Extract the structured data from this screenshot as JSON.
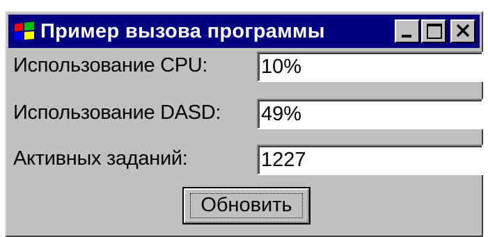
{
  "window": {
    "title": "Пример вызова программы",
    "icon": "windows-flag-icon",
    "controls": {
      "minimize": "minimize-icon",
      "maximize": "maximize-icon",
      "close": "close-icon"
    }
  },
  "form": {
    "fields": [
      {
        "label": "Использование CPU:",
        "value": "10%"
      },
      {
        "label": "Использование DASD:",
        "value": "49%"
      },
      {
        "label": "Активных заданий:",
        "value": "1227"
      }
    ],
    "refresh_button": "Обновить"
  },
  "colors": {
    "titlebar": "#000080",
    "face": "#c0c0c0",
    "field": "#ffffff"
  }
}
